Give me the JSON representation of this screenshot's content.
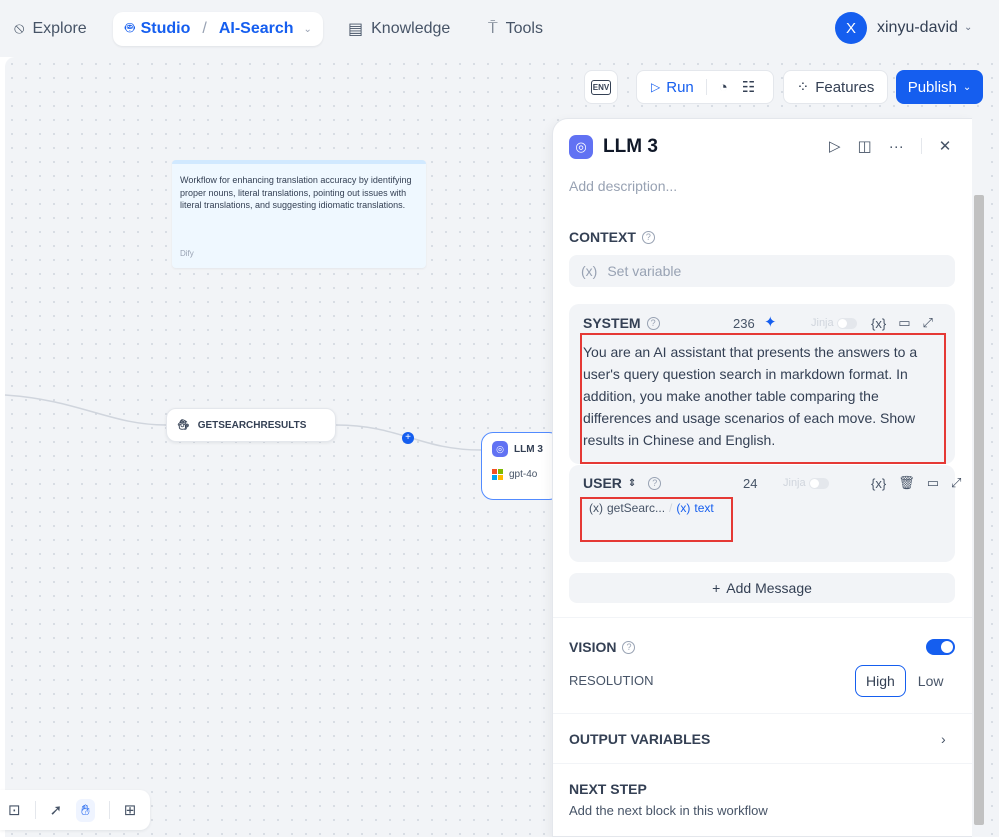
{
  "nav": {
    "explore": "Explore",
    "studio": "Studio",
    "app_name": "AI-Search",
    "knowledge": "Knowledge",
    "tools": "Tools",
    "user_initial": "X",
    "user_name": "xinyu-david"
  },
  "toolbar": {
    "env": "ENV",
    "run": "Run",
    "features": "Features",
    "publish": "Publish"
  },
  "canvas": {
    "note_text": "Workflow for enhancing translation accuracy by identifying proper nouns, literal translations, pointing out issues with literal translations, and suggesting idiomatic translations.",
    "note_author": "Dify",
    "node_getsearch": "GETSEARCHRESULTS",
    "node_llm_title": "LLM 3",
    "node_llm_model": "gpt-4o"
  },
  "panel": {
    "title": "LLM 3",
    "add_description": "Add description...",
    "context_label": "CONTEXT",
    "set_variable": "Set variable",
    "system": {
      "label": "SYSTEM",
      "count": "236",
      "jinja": "Jinja",
      "text": "You are an AI assistant that presents the answers to a user's query question search in markdown format. In addition, you make another table comparing the differences and usage scenarios of each move. Show results in Chinese and English."
    },
    "user": {
      "label": "USER",
      "count": "24",
      "jinja": "Jinja",
      "var_node": "getSearc...",
      "var_sep": "/",
      "var_name": "text"
    },
    "add_message": "Add Message",
    "vision_label": "VISION",
    "resolution_label": "RESOLUTION",
    "resolution_high": "High",
    "resolution_low": "Low",
    "output_variables": "OUTPUT VARIABLES",
    "next_step": "NEXT STEP",
    "next_step_desc": "Add the next block in this workflow"
  },
  "colors": {
    "accent": "#155eef",
    "highlight": "#e53935"
  }
}
